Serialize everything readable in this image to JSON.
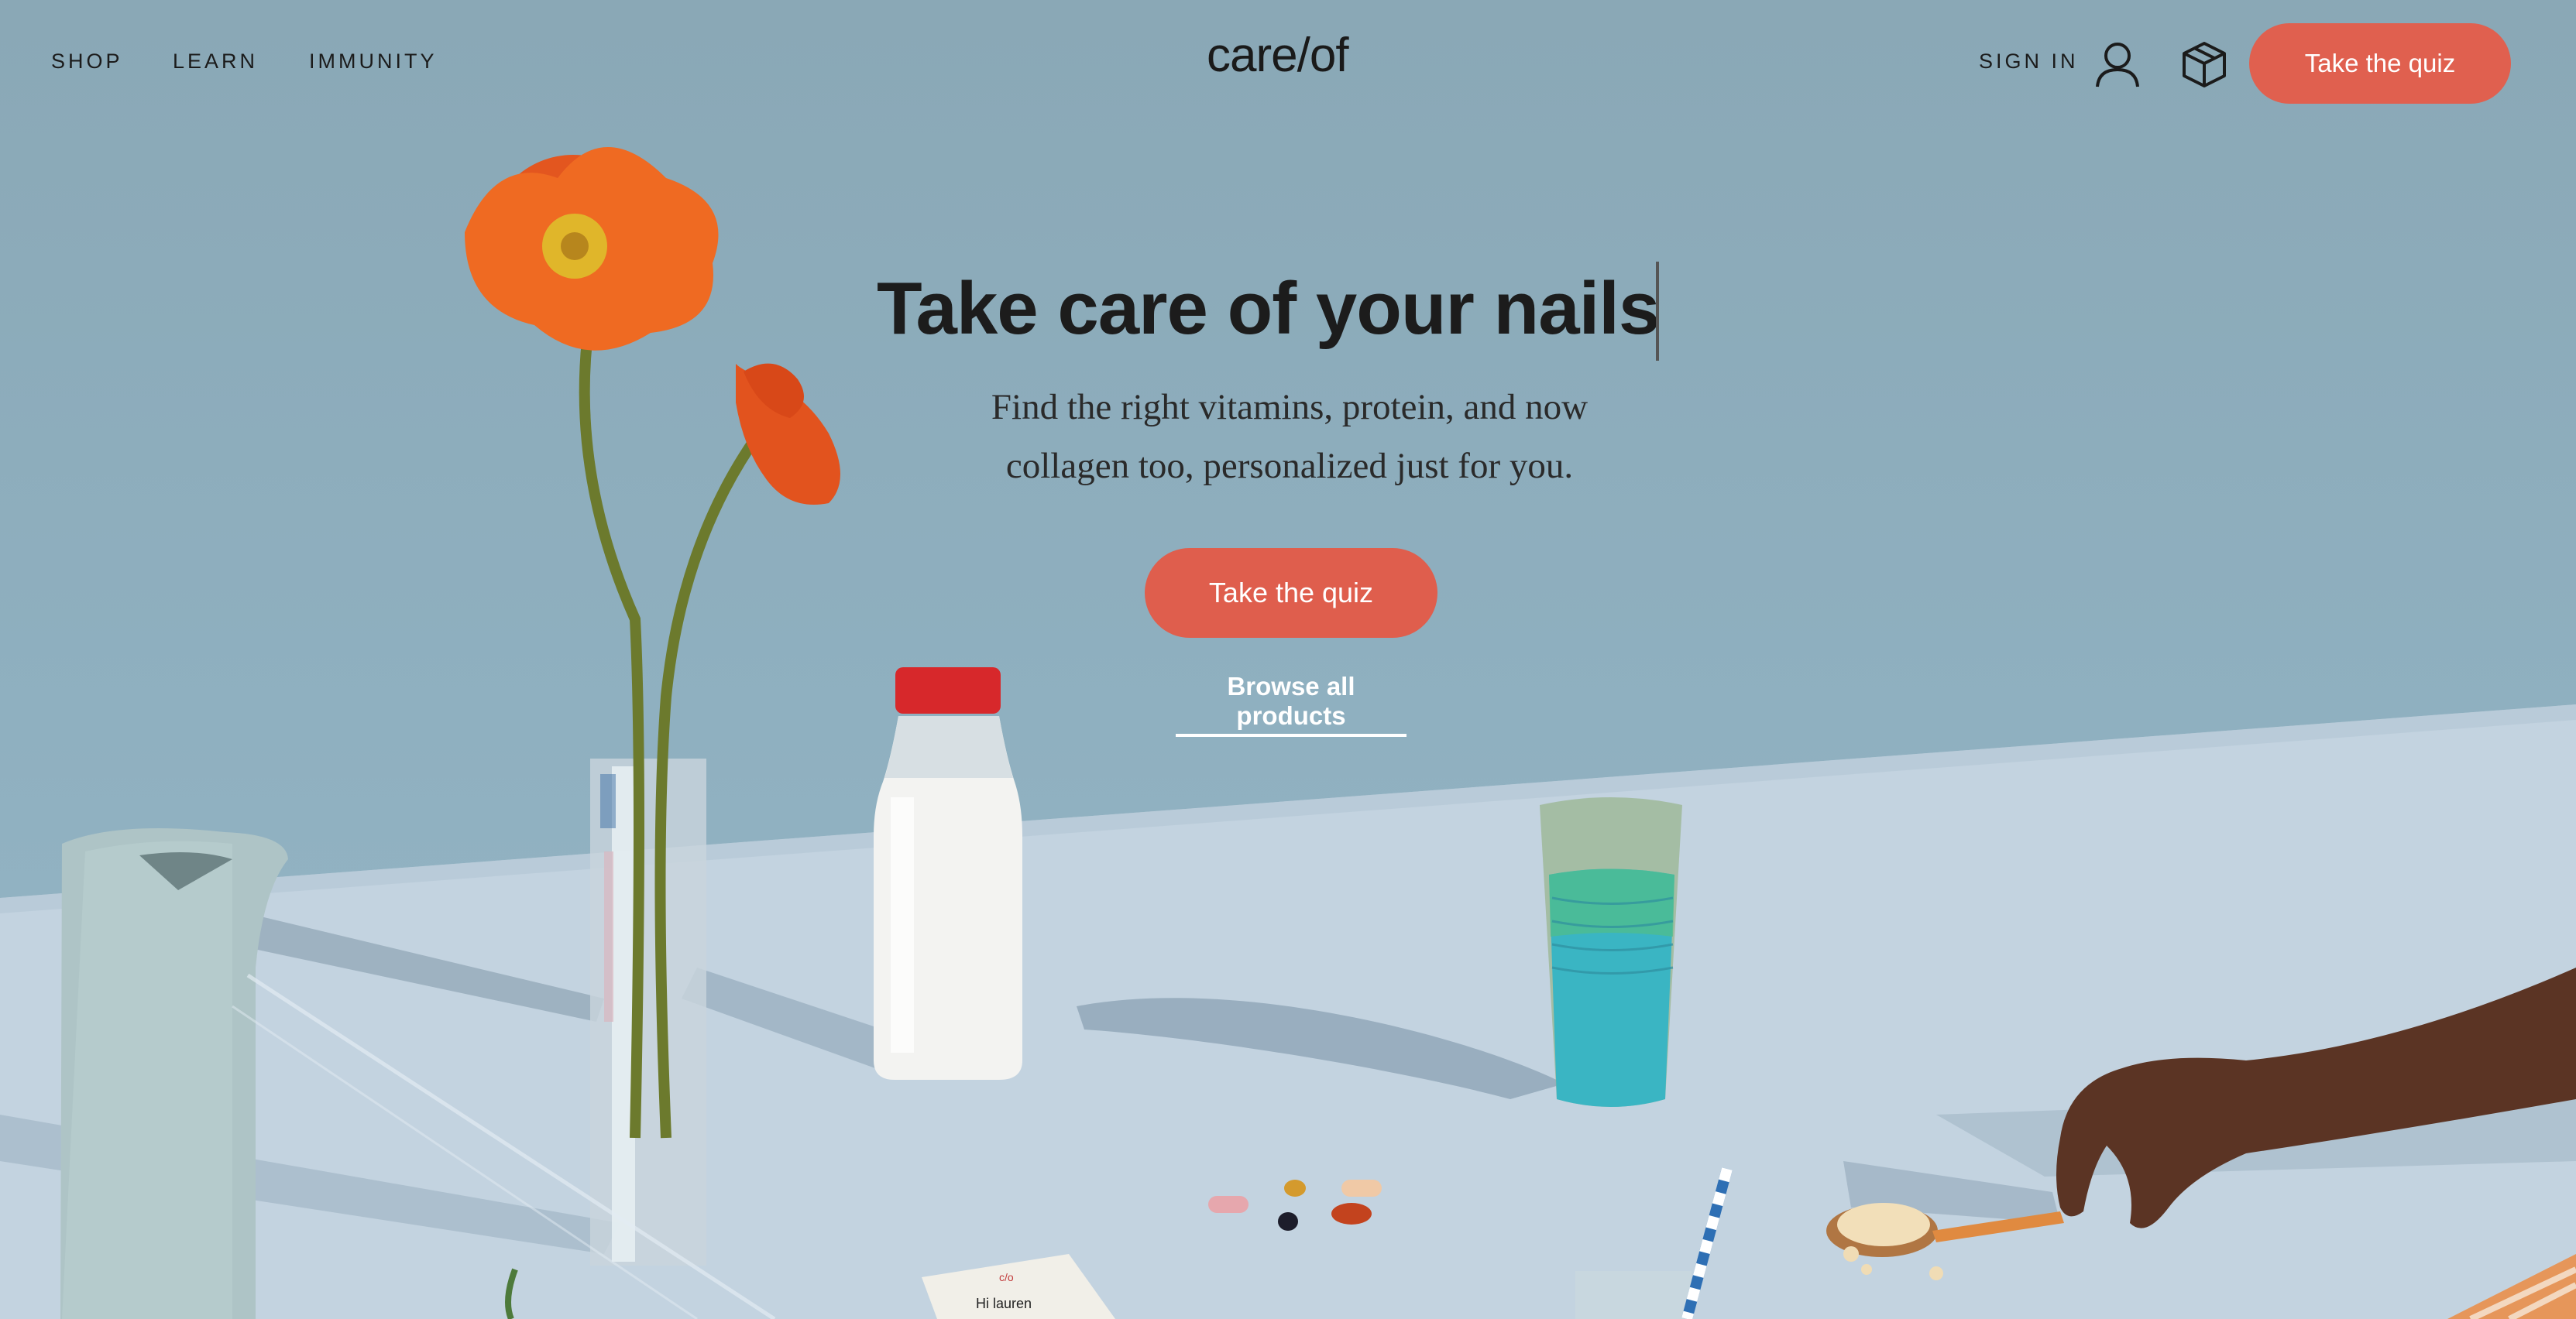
{
  "nav": {
    "links": [
      "SHOP",
      "LEARN",
      "IMMUNITY"
    ],
    "logo": "care/of",
    "sign_in": "SIGN IN",
    "cta": "Take the quiz",
    "icons": [
      "user-icon",
      "box-icon"
    ]
  },
  "hero": {
    "title": "Take care of your nails",
    "subtitle_line1": "Find the right vitamins, protein, and now",
    "subtitle_line2": "collagen too, personalized just for you.",
    "cta": "Take the quiz",
    "browse": "Browse all products"
  },
  "colors": {
    "accent": "#e0604f",
    "wall": "#8eabb9",
    "table": "#c4d4e1",
    "text": "#1c1c1c"
  }
}
